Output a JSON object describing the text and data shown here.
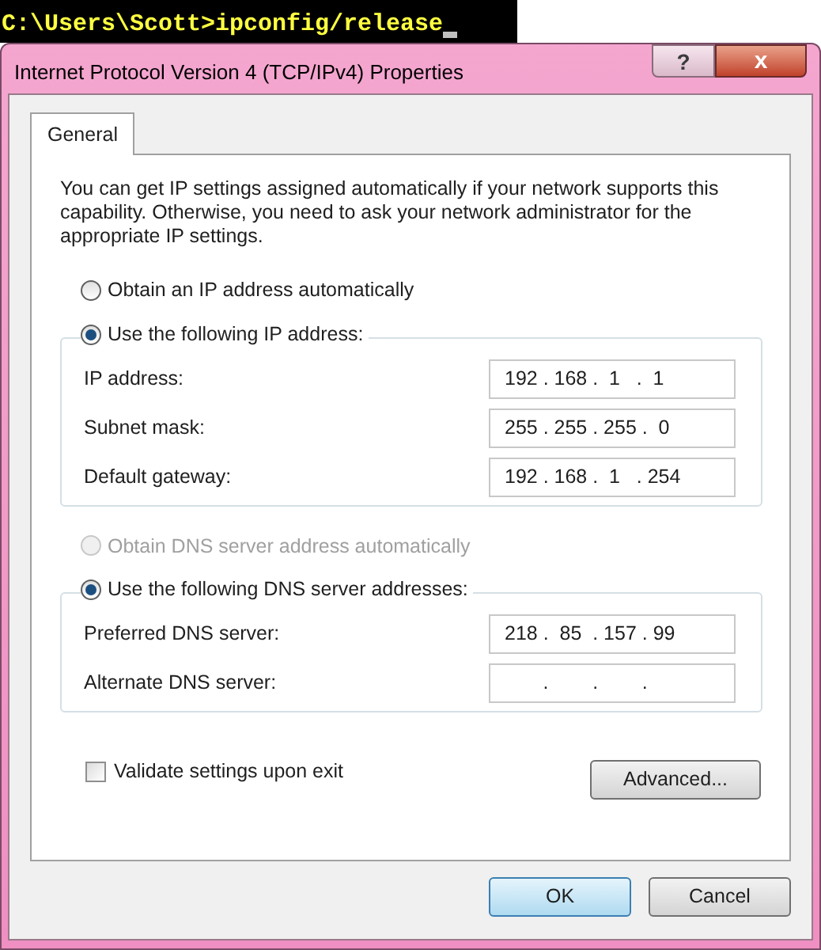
{
  "console": {
    "prompt": "C:\\Users\\Scott>ipconfig/release"
  },
  "window": {
    "title": "Internet Protocol Version 4 (TCP/IPv4) Properties",
    "help_button": "?",
    "close_button": "x"
  },
  "tabs": [
    {
      "label": "General",
      "selected": true
    }
  ],
  "description": "You can get IP settings assigned automatically if your network supports this capability. Otherwise, you need to ask your network administrator for the appropriate IP settings.",
  "sections": [
    {
      "auto_option": {
        "label": "Obtain an IP address automatically",
        "selected": false,
        "disabled": false
      },
      "manual_option": {
        "label": "Use the following IP address:",
        "selected": true,
        "disabled": false
      },
      "fields": [
        {
          "label": "IP address:",
          "value": "192 . 168 .  1   .  1"
        },
        {
          "label": "Subnet mask:",
          "value": "255 . 255 . 255 .  0"
        },
        {
          "label": "Default gateway:",
          "value": "192 . 168 .  1   . 254"
        }
      ]
    },
    {
      "auto_option": {
        "label": "Obtain DNS server address automatically",
        "selected": false,
        "disabled": true
      },
      "manual_option": {
        "label": "Use the following DNS server addresses:",
        "selected": true,
        "disabled": false
      },
      "fields": [
        {
          "label": "Preferred DNS server:",
          "value": "218 .  85  . 157 . 99"
        },
        {
          "label": "Alternate DNS server:",
          "value": "       .        .        ."
        }
      ]
    }
  ],
  "validate": {
    "label": "Validate settings upon exit",
    "checked": false
  },
  "advanced_button": "Advanced...",
  "buttons": [
    {
      "label": "OK",
      "default": true
    },
    {
      "label": "Cancel",
      "default": false
    }
  ]
}
